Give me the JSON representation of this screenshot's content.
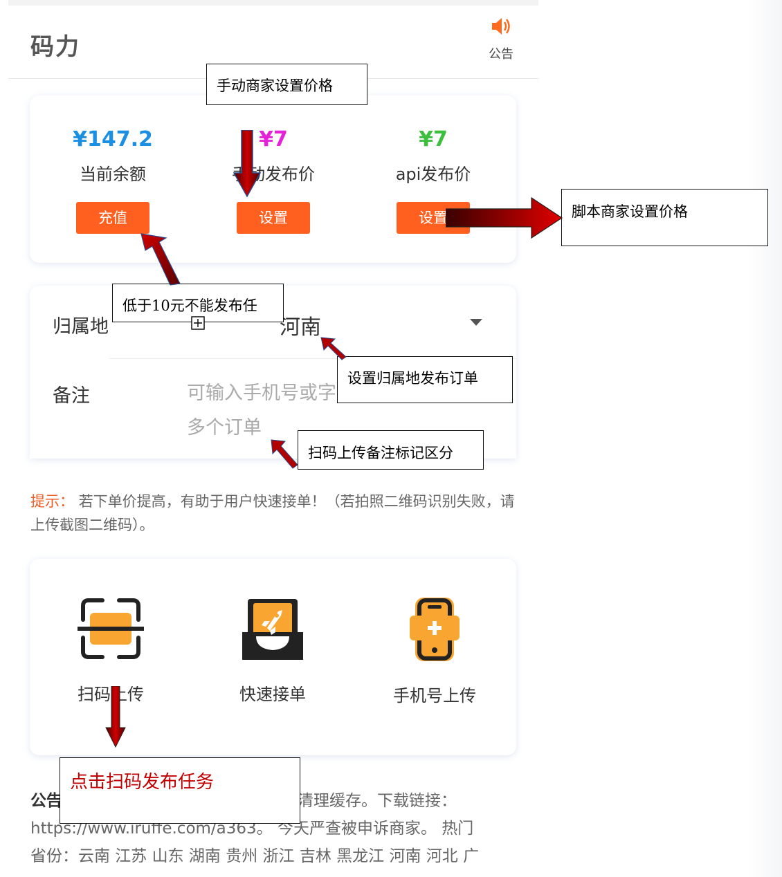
{
  "header": {
    "title": "码力",
    "notice_label": "公告"
  },
  "balance_card": {
    "columns": [
      {
        "value": "¥147.2",
        "label": "当前余额",
        "button": "充值",
        "color": "#1a8fe3"
      },
      {
        "value": "¥7",
        "label": "手动发布价",
        "button": "设置",
        "color": "#e622d8"
      },
      {
        "value": "¥7",
        "label": "api发布价",
        "button": "设置",
        "color": "#3cbf3c"
      }
    ]
  },
  "form": {
    "region_label": "归属地",
    "region_value": "河南",
    "remark_label": "备注",
    "remark_placeholder_line1": "可输入手机号或字",
    "remark_placeholder_line2": "多个订单"
  },
  "tip": {
    "prefix": "提示：",
    "text": "若下单价提高，有助于用户快速接单！（若拍照二维码识别失败，请上传截图二维码）。"
  },
  "actions": [
    {
      "label": "扫码上传",
      "icon": "scan-icon"
    },
    {
      "label": "快速接单",
      "icon": "rocket-icon"
    },
    {
      "label": "手机号上传",
      "icon": "phone-add-icon"
    }
  ],
  "announcement": {
    "prefix": "公告",
    "line1": "清理缓存。下载链接：",
    "line2": "https://www.iruffe.com/a363。 今天严查被申诉商家。 热门",
    "line3": "省份：云南 江苏 山东 湖南 贵州 浙江 吉林 黑龙江 河南 河北 广"
  },
  "annotations": {
    "manual_price": "手动商家设置价格",
    "script_price": "脚本商家设置价格",
    "min_balance": "低于10元不能发布任",
    "region_order": "设置归属地发布订单",
    "scan_remark": "扫码上传备注标记区分",
    "click_scan": "点击扫码发布任务"
  },
  "colors": {
    "accent_orange": "#ff5f1f",
    "tip_orange": "#f05a22",
    "arrow_red": "#b00000",
    "icon_orange": "#f8a531"
  }
}
